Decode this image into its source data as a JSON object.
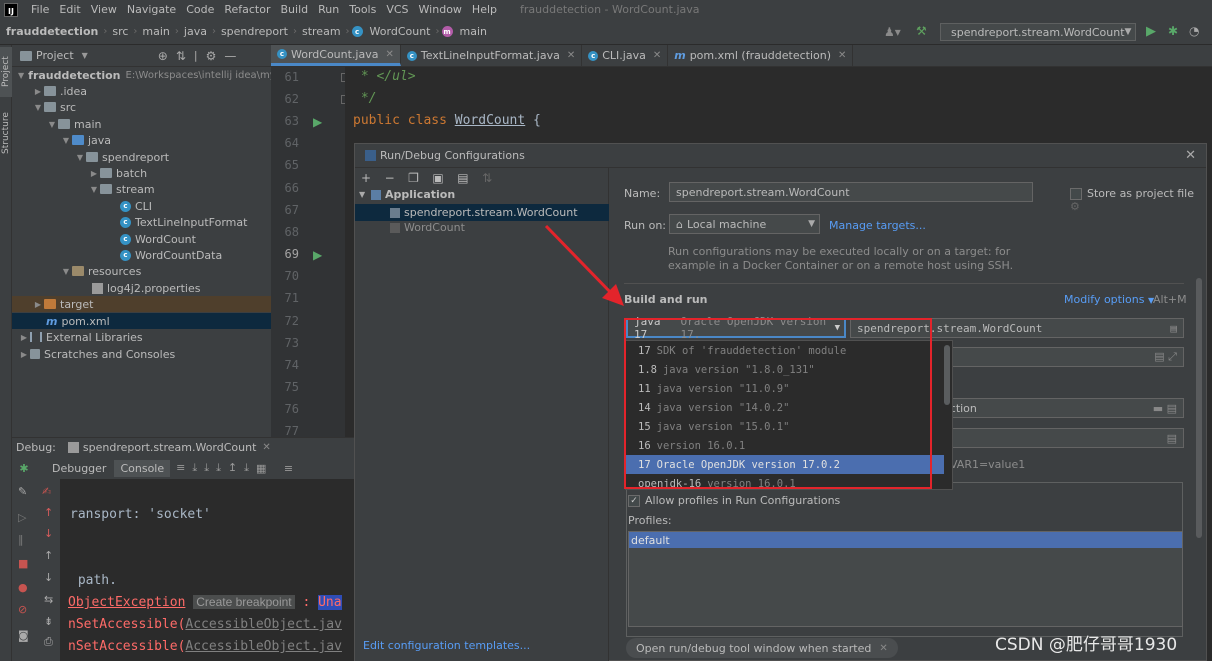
{
  "menubar": {
    "items": [
      "File",
      "Edit",
      "View",
      "Navigate",
      "Code",
      "Refactor",
      "Build",
      "Run",
      "Tools",
      "VCS",
      "Window",
      "Help"
    ],
    "title": "frauddetection - WordCount.java"
  },
  "navbar": {
    "crumbs": [
      "frauddetection",
      "src",
      "main",
      "java",
      "spendreport",
      "stream",
      "WordCount",
      "main"
    ],
    "run_config": "spendreport.stream.WordCount"
  },
  "left_strip": {
    "project": "Project",
    "structure": "Structure"
  },
  "project": {
    "header": "Project",
    "tree": [
      {
        "label": "frauddetection",
        "path": "E:\\Workspaces\\intellij idea\\my",
        "icon": "folder"
      },
      {
        "label": ".idea",
        "icon": "folder"
      },
      {
        "label": "src",
        "icon": "folder"
      },
      {
        "label": "main",
        "icon": "folder"
      },
      {
        "label": "java",
        "icon": "source-folder"
      },
      {
        "label": "spendreport",
        "icon": "package"
      },
      {
        "label": "batch",
        "icon": "package"
      },
      {
        "label": "stream",
        "icon": "package"
      },
      {
        "label": "CLI",
        "icon": "class"
      },
      {
        "label": "TextLineInputFormat",
        "icon": "class"
      },
      {
        "label": "WordCount",
        "icon": "class"
      },
      {
        "label": "WordCountData",
        "icon": "class"
      },
      {
        "label": "resources",
        "icon": "resources-folder"
      },
      {
        "label": "log4j2.properties",
        "icon": "properties"
      },
      {
        "label": "target",
        "icon": "excluded-folder"
      },
      {
        "label": "pom.xml",
        "icon": "maven"
      },
      {
        "label": "External Libraries",
        "icon": "library"
      },
      {
        "label": "Scratches and Consoles",
        "icon": "scratch"
      }
    ]
  },
  "tabs": [
    "WordCount.java",
    "TextLineInputFormat.java",
    "CLI.java",
    "pom.xml (frauddetection)"
  ],
  "editor": {
    "line_numbers": [
      "61",
      "62",
      "63",
      "64",
      "65",
      "66",
      "67",
      "68",
      "69",
      "70",
      "71",
      "72",
      "73",
      "74",
      "75",
      "76",
      "77"
    ],
    "line61": " * </ul>",
    "line62": " */",
    "line63_kw1": "public",
    "line63_kw2": "class",
    "line63_cls": "WordCount",
    "line63_brace": "{"
  },
  "debug": {
    "label": "Debug:",
    "session": "spendreport.stream.WordCount",
    "tab_debugger": "Debugger",
    "tab_console": "Console",
    "line1": "ransport: 'socket'",
    "line2": " path.",
    "line3_a": "ObjectException",
    "line3_hint": "Create breakpoint",
    "line3_b": " : ",
    "line3_c": "Una",
    "line4_a": "nSetAccessible(",
    "line4_b": "AccessibleObject.jav",
    "line5_a": "nSetAccessible(",
    "line5_b": "AccessibleObject.jav"
  },
  "dialog": {
    "title": "Run/Debug Configurations",
    "tree_group": "Application",
    "tree_items": [
      "spendreport.stream.WordCount",
      "WordCount"
    ],
    "edit_templates": "Edit configuration templates...",
    "name_label": "Name:",
    "name_value": "spendreport.stream.WordCount",
    "store_label": "Store as project file",
    "run_on_label": "Run on:",
    "run_on_value": "Local machine",
    "manage_targets": "Manage targets...",
    "run_on_hint1": "Run configurations may be executed locally or on a target: for",
    "run_on_hint2": "example in a Docker Container or on a remote host using SSH.",
    "build_run": "Build and run",
    "modify_options": "Modify options",
    "modify_shortcut": "Alt+M",
    "jre_value_v": "java 17",
    "jre_value_d": "Oracle OpenJDK version 17.",
    "main_class": "spendreport.stream.WordCount",
    "partial_ection": "ection",
    "partial_env": "e; VAR1=value1",
    "allow_profiles": "Allow profiles in Run Configurations",
    "profiles_label": "Profiles:",
    "profile_default": "default",
    "open_tool_window": "Open run/debug tool window when started"
  },
  "sdk_dropdown": [
    {
      "v": "17",
      "d": "SDK of 'frauddetection' module"
    },
    {
      "v": "1.8",
      "d": "java version \"1.8.0_131\""
    },
    {
      "v": "11",
      "d": "java version \"11.0.9\""
    },
    {
      "v": "14",
      "d": "java version \"14.0.2\""
    },
    {
      "v": "15",
      "d": "java version \"15.0.1\""
    },
    {
      "v": "16",
      "d": "version 16.0.1"
    },
    {
      "v": "17",
      "d": "Oracle OpenJDK version 17.0.2"
    },
    {
      "v": "openjdk-16",
      "d": "version 16.0.1"
    }
  ],
  "sdk_selected_index": 6,
  "watermark": "CSDN @肥仔哥哥1930",
  "colors": {
    "accent": "#4b6eaf",
    "highlight_box": "#e3242b",
    "link": "#589df6"
  }
}
